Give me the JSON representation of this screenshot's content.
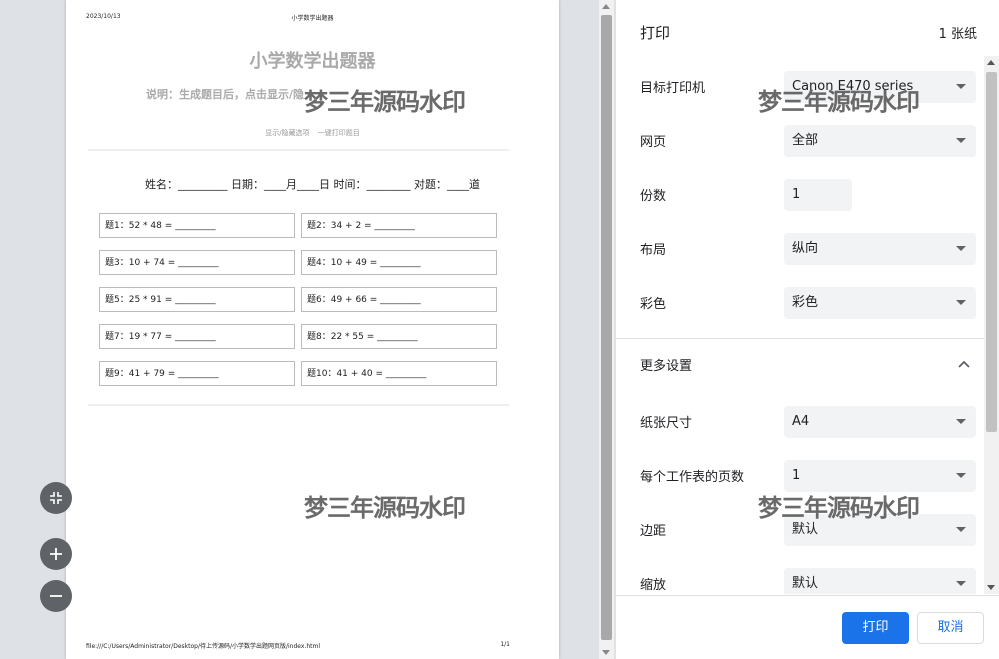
{
  "preview": {
    "header_date": "2023/10/13",
    "header_title": "小学数学出题器",
    "doc_title": "小学数学出题器",
    "doc_description": "说明：生成题目后，点击显示/隐",
    "links": [
      "显示/隐藏选项",
      "一键打印题目"
    ],
    "info_line": "姓名：_________ 日期：____月____日 时间：________ 对题：____道",
    "questions": [
      "题1：52 * 48 = _________",
      "题2：34 + 2 = _________",
      "题3：10 + 74 = _________",
      "题4：10 + 49 = _________",
      "题5：25 * 91 = _________",
      "题6：49 + 66 = _________",
      "题7：19 * 77 = _________",
      "题8：22 * 55 = _________",
      "题9：41 + 79 = _________",
      "题10：41 + 40 = _________"
    ],
    "footer_path": "file:///C:/Users/Administrator/Desktop/待上传源码/小学数学出题网页版/index.html",
    "footer_page": "1/1",
    "watermark": "梦三年源码水印"
  },
  "panel": {
    "title": "打印",
    "sheet_count": "1 张纸",
    "printer_label": "目标打印机",
    "printer_value": "Canon E470 series",
    "pages_label": "网页",
    "pages_value": "全部",
    "copies_label": "份数",
    "copies_value": "1",
    "layout_label": "布局",
    "layout_value": "纵向",
    "color_label": "彩色",
    "color_value": "彩色",
    "more_label": "更多设置",
    "paper_label": "纸张尺寸",
    "paper_value": "A4",
    "pps_label": "每个工作表的页数",
    "pps_value": "1",
    "margin_label": "边距",
    "margin_value": "默认",
    "scale_label": "缩放",
    "scale_value": "默认",
    "print_button": "打印",
    "cancel_button": "取消",
    "watermark": "梦三年源码水印"
  },
  "colors": {
    "accent": "#1a73e8",
    "preview_bg": "#dee1e6",
    "select_bg": "#f1f3f4"
  },
  "icons": {
    "fit": "fit-to-page-icon",
    "zoom_in": "plus-icon",
    "zoom_out": "minus-icon",
    "expand": "chevron-up-icon"
  }
}
